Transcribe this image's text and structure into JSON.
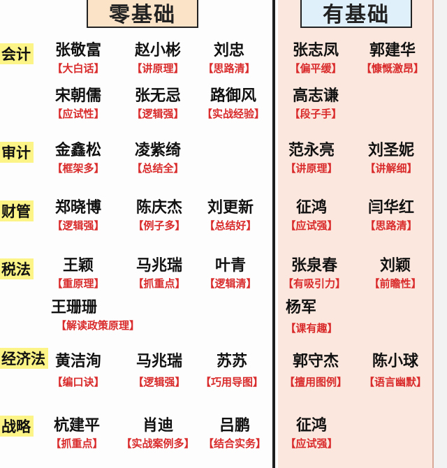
{
  "headers": {
    "zero": "零基础",
    "some": "有基础"
  },
  "subjects": [
    {
      "name": "会计"
    },
    {
      "name": "审计"
    },
    {
      "name": "财管"
    },
    {
      "name": "税法"
    },
    {
      "name": "经济法"
    },
    {
      "name": "战略"
    }
  ],
  "left": [
    {
      "name": "张敬富",
      "tag": "【大白话】"
    },
    {
      "name": "赵小彬",
      "tag": "【讲原理】"
    },
    {
      "name": "刘忠",
      "tag": "【思路清】"
    },
    {
      "name": "宋朝儒",
      "tag": "【应试性】"
    },
    {
      "name": "张无忌",
      "tag": "【逻辑强】"
    },
    {
      "name": "路御风",
      "tag": "【实战经验】"
    },
    {
      "name": "金鑫松",
      "tag": "【框架多】"
    },
    {
      "name": "凌紫绮",
      "tag": "【总结全】"
    },
    {
      "name": "郑晓博",
      "tag": "【逻辑强】"
    },
    {
      "name": "陈庆杰",
      "tag": "【例子多】"
    },
    {
      "name": "刘更新",
      "tag": "【总结好】"
    },
    {
      "name": "王颖",
      "tag": "【重原理】"
    },
    {
      "name": "马兆瑞",
      "tag": "【抓重点】"
    },
    {
      "name": "叶青",
      "tag": "【逻辑清】"
    },
    {
      "name": "王珊珊",
      "tag": "【解读政策原理】"
    },
    {
      "name": "黄洁洵",
      "tag": "【编口诀】"
    },
    {
      "name": "马兆瑞",
      "tag": "【逻辑强】"
    },
    {
      "name": "苏苏",
      "tag": "【巧用导图】"
    },
    {
      "name": "杭建平",
      "tag": "【抓重点】"
    },
    {
      "name": "肖迪",
      "tag": "【实战案例多】"
    },
    {
      "name": "吕鹏",
      "tag": "【结合实务】"
    }
  ],
  "right": [
    {
      "name": "张志凤",
      "tag": "【偏平缓】"
    },
    {
      "name": "郭建华",
      "tag": "【慷慨激昂】"
    },
    {
      "name": "高志谦",
      "tag": "【段子手】"
    },
    {
      "name": "范永亮",
      "tag": "【讲原理】"
    },
    {
      "name": "刘圣妮",
      "tag": "【讲解细】"
    },
    {
      "name": "征鸿",
      "tag": "【应试强】"
    },
    {
      "name": "闫华红",
      "tag": "【思路清】"
    },
    {
      "name": "张泉春",
      "tag": "【有吸引力】"
    },
    {
      "name": "刘颖",
      "tag": "【前瞻性】"
    },
    {
      "name": "杨军",
      "tag": "【课有趣】"
    },
    {
      "name": "郭守杰",
      "tag": "【擅用图例】"
    },
    {
      "name": "陈小球",
      "tag": "【语言幽默】"
    },
    {
      "name": "征鸿",
      "tag": "【应试强】"
    }
  ]
}
